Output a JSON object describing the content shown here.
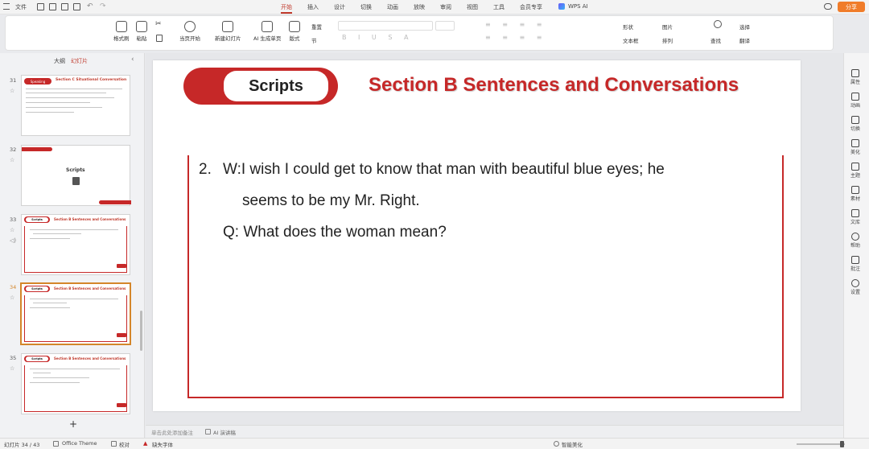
{
  "app": {
    "file_menu": "文件",
    "tabs": [
      "开始",
      "插入",
      "设计",
      "切换",
      "动画",
      "放映",
      "审阅",
      "视图",
      "工具",
      "会员专享",
      "WPS AI"
    ],
    "active_tab": "开始",
    "share_button": "分享"
  },
  "ribbon": {
    "format_painter": "格式刷",
    "paste": "粘贴",
    "from_current": "当页开始",
    "new_slide": "新建幻灯片",
    "ai_gen": "AI 生成单页",
    "layout": "版式",
    "reset": "重置",
    "section": "节",
    "shape": "形状",
    "picture": "图片",
    "textbox": "文本框",
    "arrange": "排列",
    "find": "查找",
    "select": "选择",
    "translate": "翻译"
  },
  "panel": {
    "tab_outline": "大纲",
    "tab_slides": "幻灯片",
    "add_button": "+",
    "thumbs": [
      {
        "num": "31",
        "label": "Speaking",
        "title": "Section C  Situational Conversation"
      },
      {
        "num": "32",
        "label": "Scripts",
        "title": ""
      },
      {
        "num": "33",
        "label": "Scripts",
        "title": "Section B  Sentences and Conversations"
      },
      {
        "num": "34",
        "label": "Scripts",
        "title": "Section B  Sentences and Conversations"
      },
      {
        "num": "35",
        "label": "Scripts",
        "title": "Section B  Sentences and Conversations"
      }
    ]
  },
  "slide": {
    "label": "Scripts",
    "title": "Section B  Sentences and Conversations",
    "item_number": "2.",
    "line1": "W:I wish I could get to know that man with beautiful blue eyes; he",
    "line2": "seems to be my Mr. Right.",
    "question": "Q: What does the woman mean?"
  },
  "rightbar": [
    "属性",
    "动画",
    "切换",
    "美化",
    "主题",
    "素材",
    "文库",
    "帮助",
    "批注",
    "设置"
  ],
  "notes": {
    "placeholder": "单击此处添加备注",
    "ai_script": "AI 演讲稿"
  },
  "status": {
    "slide_counter": "幻灯片 34 / 43",
    "theme": "Office Theme",
    "proof": "校对",
    "missing_font": "缺失字体",
    "smart_beautify": "智能美化"
  },
  "colors": {
    "accent": "#c0392b",
    "brand_red": "#c62828",
    "share_orange": "#f07c2a"
  }
}
